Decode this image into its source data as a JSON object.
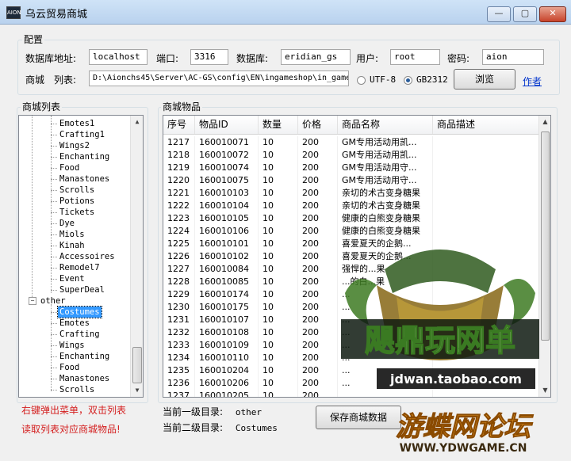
{
  "window": {
    "title": "乌云贸易商城",
    "app_icon_text": "AION",
    "minimize": "—",
    "maximize": "▢",
    "close": "✕"
  },
  "config": {
    "group_label": "配置",
    "db_address_label": "数据库地址:",
    "db_address_value": "localhost",
    "port_label": "端口:",
    "port_value": "3316",
    "db_label": "数据库:",
    "db_value": "eridian_gs",
    "user_label": "用户:",
    "user_value": "root",
    "password_label": "密码:",
    "password_value": "aion",
    "shop_list_label": "商城　列表:",
    "shop_list_path": "D:\\Aionchs45\\Server\\AC-GS\\config\\EN\\ingameshop\\in_game",
    "encoding_utf8": "UTF-8",
    "encoding_gb": "GB2312",
    "selected_encoding": "GB2312",
    "browse_button": "浏览",
    "author_link": "作者"
  },
  "tree": {
    "group_label": "商城列表",
    "items": [
      {
        "label": "Emotes1",
        "level": 2,
        "selected": false
      },
      {
        "label": "Crafting1",
        "level": 2,
        "selected": false
      },
      {
        "label": "Wings2",
        "level": 2,
        "selected": false
      },
      {
        "label": "Enchanting",
        "level": 2,
        "selected": false
      },
      {
        "label": "Food",
        "level": 2,
        "selected": false
      },
      {
        "label": "Manastones",
        "level": 2,
        "selected": false
      },
      {
        "label": "Scrolls",
        "level": 2,
        "selected": false
      },
      {
        "label": "Potions",
        "level": 2,
        "selected": false
      },
      {
        "label": "Tickets",
        "level": 2,
        "selected": false
      },
      {
        "label": "Dye",
        "level": 2,
        "selected": false
      },
      {
        "label": "Miols",
        "level": 2,
        "selected": false
      },
      {
        "label": "Kinah",
        "level": 2,
        "selected": false
      },
      {
        "label": "Accessoires",
        "level": 2,
        "selected": false
      },
      {
        "label": "Remodel7",
        "level": 2,
        "selected": false
      },
      {
        "label": "Event",
        "level": 2,
        "selected": false
      },
      {
        "label": "SuperDeal",
        "level": 2,
        "selected": false
      },
      {
        "label": "other",
        "level": 1,
        "selected": false,
        "expander": "−"
      },
      {
        "label": "Costumes",
        "level": 2,
        "selected": true
      },
      {
        "label": "Emotes",
        "level": 2,
        "selected": false
      },
      {
        "label": "Crafting",
        "level": 2,
        "selected": false
      },
      {
        "label": "Wings",
        "level": 2,
        "selected": false
      },
      {
        "label": "Enchanting",
        "level": 2,
        "selected": false
      },
      {
        "label": "Food",
        "level": 2,
        "selected": false
      },
      {
        "label": "Manastones",
        "level": 2,
        "selected": false
      },
      {
        "label": "Scrolls",
        "level": 2,
        "selected": false
      }
    ],
    "note_line1": "右键弹出菜单，双击列表",
    "note_line2": "读取列表对应商城物品!"
  },
  "items": {
    "group_label": "商城物品",
    "columns": [
      "序号",
      "物品ID",
      "数量",
      "价格",
      "商品名称",
      "商品描述"
    ],
    "rows": [
      [
        "1217",
        "160010071",
        "10",
        "200",
        "GM专用活动用凯...",
        ""
      ],
      [
        "1218",
        "160010072",
        "10",
        "200",
        "GM专用活动用凯...",
        ""
      ],
      [
        "1219",
        "160010074",
        "10",
        "200",
        "GM专用活动用守...",
        ""
      ],
      [
        "1220",
        "160010075",
        "10",
        "200",
        "GM专用活动用守...",
        ""
      ],
      [
        "1221",
        "160010103",
        "10",
        "200",
        "亲切的术古变身糖果",
        ""
      ],
      [
        "1222",
        "160010104",
        "10",
        "200",
        "亲切的术古变身糖果",
        ""
      ],
      [
        "1223",
        "160010105",
        "10",
        "200",
        "健康的白熊变身糖果",
        ""
      ],
      [
        "1224",
        "160010106",
        "10",
        "200",
        "健康的白熊变身糖果",
        ""
      ],
      [
        "1225",
        "160010101",
        "10",
        "200",
        "喜爱夏天的企鹅...",
        ""
      ],
      [
        "1226",
        "160010102",
        "10",
        "200",
        "喜爱夏天的企鹅...",
        ""
      ],
      [
        "1227",
        "160010084",
        "10",
        "200",
        "强悍的...果",
        ""
      ],
      [
        "1228",
        "160010085",
        "10",
        "200",
        "...的白...果",
        ""
      ],
      [
        "1229",
        "160010174",
        "10",
        "200",
        "...",
        ""
      ],
      [
        "1230",
        "160010175",
        "10",
        "200",
        "...",
        ""
      ],
      [
        "1231",
        "160010107",
        "10",
        "200",
        "...",
        ""
      ],
      [
        "1232",
        "160010108",
        "10",
        "200",
        "...",
        ""
      ],
      [
        "1233",
        "160010109",
        "10",
        "200",
        "...",
        ""
      ],
      [
        "1234",
        "160010110",
        "10",
        "200",
        "...",
        ""
      ],
      [
        "1235",
        "160010204",
        "10",
        "200",
        "...",
        ""
      ],
      [
        "1236",
        "160010206",
        "10",
        "200",
        "...",
        ""
      ],
      [
        "1237",
        "160010205",
        "10",
        "200",
        "...",
        ""
      ]
    ]
  },
  "status": {
    "level1_label": "当前一级目录:",
    "level1_value": "other",
    "level2_label": "当前二级目录:",
    "level2_value": "Costumes",
    "save_button": "保存商城数据"
  },
  "watermark": {
    "brand_top": "飓鼎玩网单",
    "url_top": "jdwan.taobao.com",
    "brand_bottom": "游蝶网论坛",
    "url_bottom": "WWW.YDWGAME.CN"
  }
}
